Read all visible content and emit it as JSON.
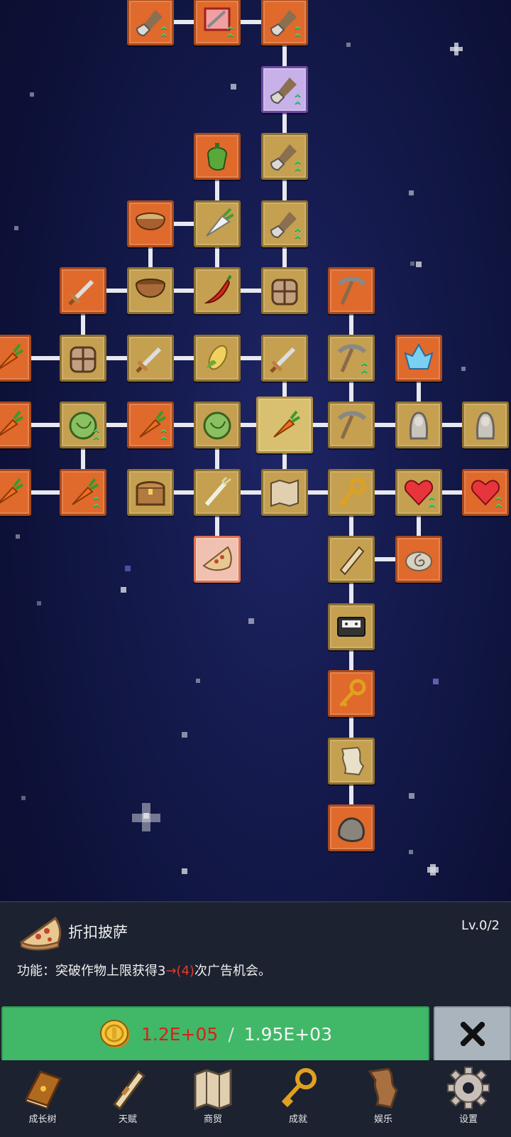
{
  "info_panel": {
    "item_name": "折扣披萨",
    "level": "Lv.0/2",
    "description_prefix": "功能：突破作物上限获得3",
    "description_arrow": "→",
    "description_highlight": "(4)",
    "description_suffix": "次广告机会。",
    "item_icon": "pizza-icon"
  },
  "cost_button": {
    "current": "1.2E+05",
    "separator": "/",
    "required": "1.95E+03",
    "icon": "gold-coin-icon"
  },
  "close_button": {
    "icon": "close-x-icon"
  },
  "bottom_nav": [
    {
      "label": "成长树",
      "icon": "book-icon"
    },
    {
      "label": "天赋",
      "icon": "scroll-icon"
    },
    {
      "label": "商贸",
      "icon": "map-icon"
    },
    {
      "label": "成就",
      "icon": "key-icon"
    },
    {
      "label": "娱乐",
      "icon": "paper-icon"
    },
    {
      "label": "设置",
      "icon": "gear-icon"
    }
  ],
  "colors": {
    "node_gold": "#c4a050",
    "node_orange": "#e0692c",
    "cost_button_bg": "#40b868",
    "cost_insufficient": "#d8201a",
    "background": "#141a4c"
  },
  "skill_tree": {
    "selected_node": "pizza-icon",
    "nodes": [
      {
        "icon": "shovel-icon",
        "style": "orange",
        "upgrade": true
      },
      {
        "icon": "card-icon",
        "style": "orange",
        "upgrade": true
      },
      {
        "icon": "shovel-icon",
        "style": "orange",
        "upgrade": true
      },
      {
        "icon": "shovel-icon",
        "style": "purple",
        "upgrade": true
      },
      {
        "icon": "pepper-icon",
        "style": "orange",
        "upgrade": false
      },
      {
        "icon": "shovel-icon",
        "style": "gold",
        "upgrade": true
      },
      {
        "icon": "bowl-soup-icon",
        "style": "orange",
        "upgrade": false
      },
      {
        "icon": "radish-icon",
        "style": "gold",
        "upgrade": false
      },
      {
        "icon": "shovel-icon",
        "style": "gold",
        "upgrade": true
      },
      {
        "icon": "sword-icon",
        "style": "orange",
        "upgrade": false
      },
      {
        "icon": "bowl-icon",
        "style": "gold",
        "upgrade": false
      },
      {
        "icon": "chili-icon",
        "style": "gold",
        "upgrade": false
      },
      {
        "icon": "backpack-icon",
        "style": "gold",
        "upgrade": false
      },
      {
        "icon": "pickaxe-icon",
        "style": "orange",
        "upgrade": false
      },
      {
        "icon": "backpack-icon",
        "style": "gold",
        "upgrade": false
      },
      {
        "icon": "sword-icon",
        "style": "gold",
        "upgrade": false
      },
      {
        "icon": "corn-icon",
        "style": "gold",
        "upgrade": false
      },
      {
        "icon": "sword-icon",
        "style": "gold",
        "upgrade": false
      },
      {
        "icon": "pickaxe-icon",
        "style": "gold",
        "upgrade": true
      },
      {
        "icon": "crystal-icon",
        "style": "orange",
        "upgrade": false
      },
      {
        "icon": "cabbage-icon",
        "style": "gold",
        "upgrade": true
      },
      {
        "icon": "carrot-icon",
        "style": "orange",
        "upgrade": true
      },
      {
        "icon": "cabbage-icon",
        "style": "gold",
        "upgrade": false
      },
      {
        "icon": "carrot-icon",
        "style": "selected",
        "upgrade": false
      },
      {
        "icon": "pickaxe-icon",
        "style": "gold",
        "upgrade": false
      },
      {
        "icon": "statue-icon",
        "style": "gold",
        "upgrade": false
      },
      {
        "icon": "statue-icon",
        "style": "gold",
        "upgrade": false
      },
      {
        "icon": "carrot-icon",
        "style": "orange",
        "upgrade": true
      },
      {
        "icon": "chest-icon",
        "style": "gold",
        "upgrade": false
      },
      {
        "icon": "leek-icon",
        "style": "gold",
        "upgrade": false
      },
      {
        "icon": "map-icon",
        "style": "gold",
        "upgrade": false
      },
      {
        "icon": "key-icon",
        "style": "gold",
        "upgrade": false
      },
      {
        "icon": "heart-icon",
        "style": "gold",
        "upgrade": true
      },
      {
        "icon": "heart-icon",
        "style": "orange",
        "upgrade": true
      },
      {
        "icon": "pizza-icon",
        "style": "pink",
        "upgrade": false
      },
      {
        "icon": "scroll-icon",
        "style": "gold",
        "upgrade": false
      },
      {
        "icon": "fossil-icon",
        "style": "orange",
        "upgrade": false
      },
      {
        "icon": "cassette-icon",
        "style": "gold",
        "upgrade": false
      },
      {
        "icon": "key-icon",
        "style": "orange",
        "upgrade": false
      },
      {
        "icon": "paper-icon",
        "style": "gold",
        "upgrade": false
      },
      {
        "icon": "rock-icon",
        "style": "orange",
        "upgrade": false
      }
    ]
  }
}
